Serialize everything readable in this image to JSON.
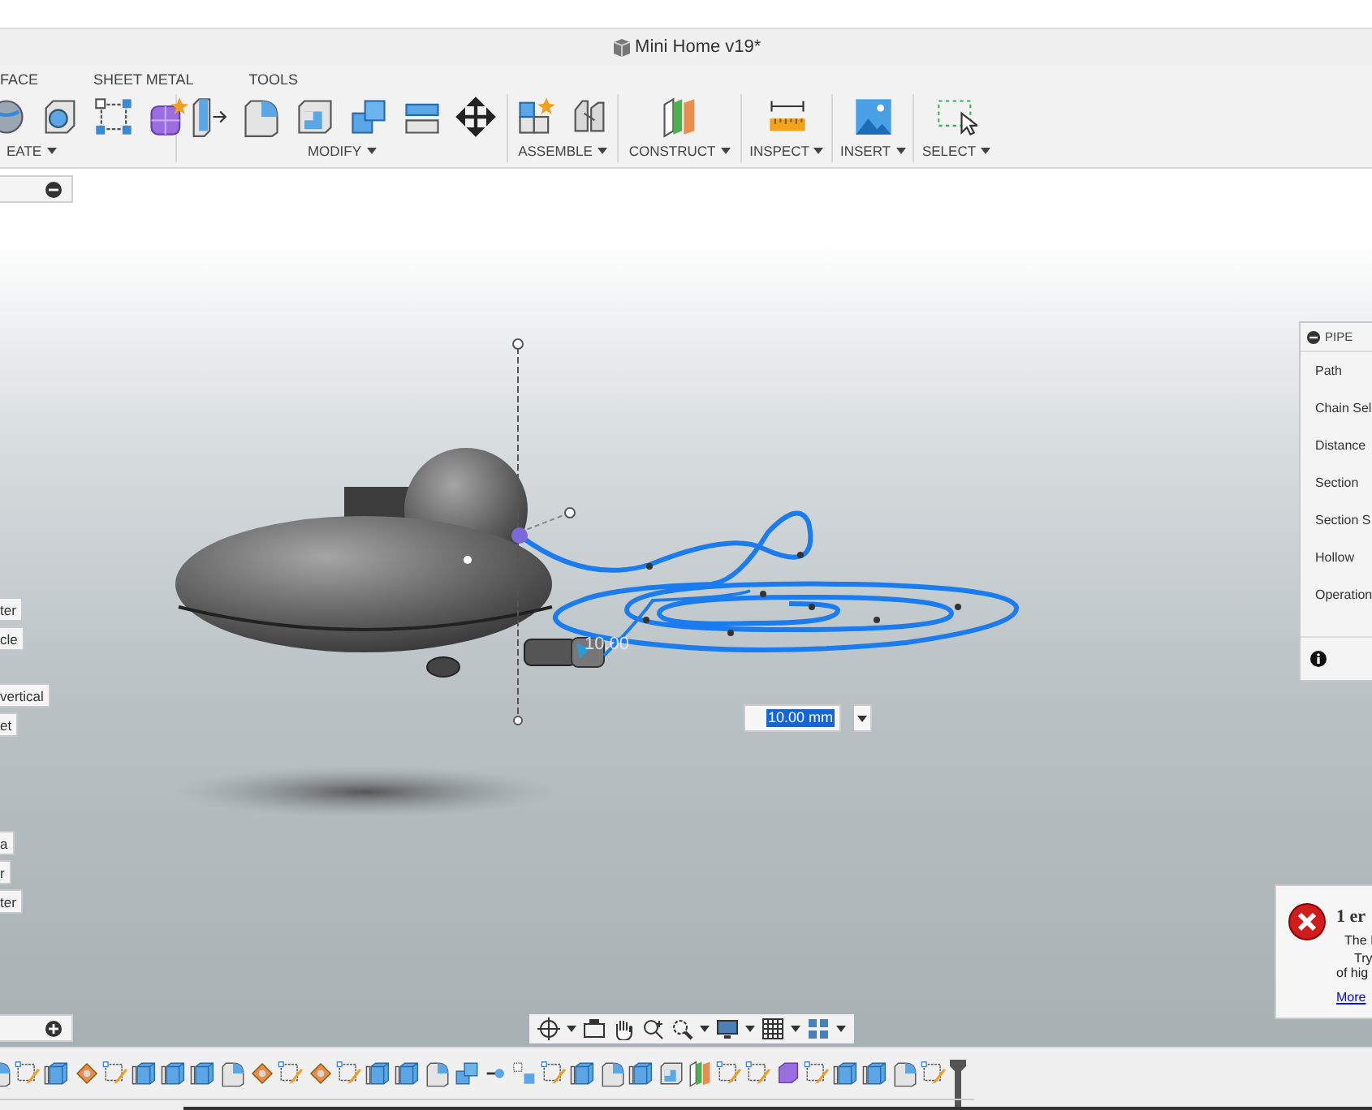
{
  "window": {
    "title": "Mini Home v19*"
  },
  "toolbar": {
    "tabs": [
      {
        "label": "FACE"
      },
      {
        "label": "SHEET METAL"
      },
      {
        "label": "TOOLS"
      }
    ],
    "groups": [
      {
        "label": "EATE"
      },
      {
        "label": "MODIFY"
      },
      {
        "label": "ASSEMBLE"
      },
      {
        "label": "CONSTRUCT"
      },
      {
        "label": "INSPECT"
      },
      {
        "label": "INSERT"
      },
      {
        "label": "SELECT"
      }
    ]
  },
  "viewport": {
    "left_labels": [
      {
        "text": "ter"
      },
      {
        "text": "cle"
      },
      {
        "text": "vertical"
      },
      {
        "text": "et"
      },
      {
        "text": "a"
      },
      {
        "text": "r"
      },
      {
        "text": "ter"
      }
    ],
    "dimension_label": "10.00",
    "dimension_input": {
      "value": "10.00 mm"
    }
  },
  "pipe_panel": {
    "title": "PIPE",
    "rows": [
      "Path",
      "Chain Sel",
      "Distance",
      "Section",
      "Section S",
      "Hollow",
      "Operation"
    ]
  },
  "error_popup": {
    "title": "1 er",
    "lines": [
      "The I",
      "Try",
      "of hig"
    ],
    "link": "More"
  }
}
